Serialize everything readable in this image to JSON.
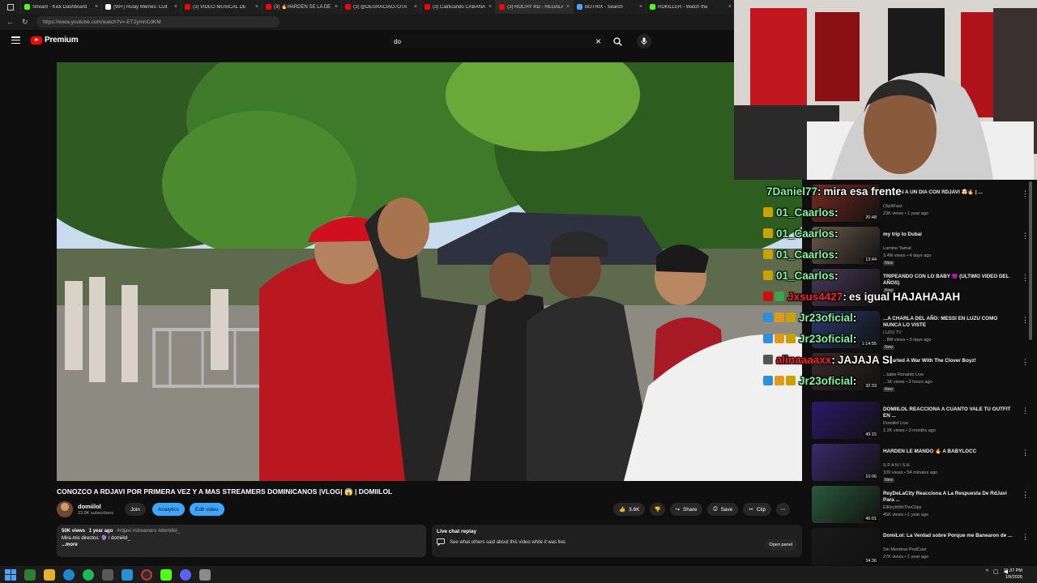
{
  "browser": {
    "tabs": [
      {
        "label": "Stream - Kick Dashboard",
        "color": "#53fc18"
      },
      {
        "label": "(99+) Rulay Memes: Cult",
        "color": "#ffffff"
      },
      {
        "label": "(3) VIDEO MUSICAL DE",
        "color": "#ff0000"
      },
      {
        "label": "(3) 🔥HARDEN SE LA DE",
        "color": "#ff0000"
      },
      {
        "label": "(3) @DEGRACIAO7OTA",
        "color": "#ff0000"
      },
      {
        "label": "(3) Calificando CABAÑA",
        "color": "#ff0000"
      },
      {
        "label": "(3) ROCHY RD - REGALA",
        "color": "#ff0000"
      },
      {
        "label": "BOTRIX - Search",
        "color": "#4aa3ff"
      },
      {
        "label": "RDKILLER - Watch the",
        "color": "#53fc18"
      }
    ],
    "url": "https://www.youtube.com/watch?v=-ET2ymnCdKM",
    "back_icon": "arrow-left-icon",
    "reload_icon": "reload-icon"
  },
  "youtube": {
    "logo_text": "Premium",
    "search_query": "do",
    "video_title": "CONOZCO A RDJAVI POR PRIMERA VEZ Y A MAS STREAMERS DOMINICANOS |VLOG| 😱 | DOMIILOL",
    "channel_name": "domiilol",
    "subscribers": "23.9K subscribers",
    "join_label": "Join",
    "analytics_label": "Analytics",
    "edit_label": "Edit video",
    "likes": "3.6K",
    "share_label": "Share",
    "save_label": "Save",
    "clip_label": "Clip",
    "more_label": "⋯",
    "desc_views": "50K views",
    "desc_time": "1 year ago",
    "desc_tags": "#rdjavi #streamers #domiilol_",
    "desc_line2": "Mira mis directos: 🔮 / domiilol_",
    "desc_more": "...more",
    "chat_replay_title": "Live chat replay",
    "chat_replay_sub": "See what others said about this video while it was live.",
    "open_panel_label": "Open panel"
  },
  "recommendations": [
    {
      "title": "...CCIÓN A UN DIA CON RDJAVI 🤯🔥 | ...",
      "channel": "ClipItFast",
      "meta": "23K views • 1 year ago",
      "duration": "20:48",
      "badge": ""
    },
    {
      "title": "my trip to Dubai",
      "channel": "Lamine Yamal",
      "meta": "3.4M views • 4 days ago",
      "duration": "13:44",
      "badge": "New"
    },
    {
      "title": "TRIPEANDO CON LO BABY 😈 (ULTIMO VIDEO DEL AÑOS)",
      "channel": "",
      "meta": "",
      "duration": "",
      "badge": "New"
    },
    {
      "title": "...A CHARLA DEL AÑO: MESSI EN LUZU COMO NUNCA LO VISTE",
      "channel": "LUZU TV",
      "meta": "...8M views • 3 days ago",
      "duration": "1:14:55",
      "badge": "New"
    },
    {
      "title": "...Started A War With The Clover Boyz!",
      "channel": "...table Ronaldo Live",
      "meta": "...1K views • 2 hours ago",
      "duration": "32:33",
      "badge": "New"
    },
    {
      "title": "DOMIILOL REACCIONA A CUANTO VALE TU OUTFIT EN ...",
      "channel": "Domiilol Live",
      "meta": "1.2K views • 3 months ago",
      "duration": "49:15",
      "badge": ""
    },
    {
      "title": "HARDEN LE MANDO 🔥 A BABYLOCC",
      "channel": "S P A N I S H",
      "meta": "109 views • 54 minutes ago",
      "duration": "10:06",
      "badge": "New"
    },
    {
      "title": "ReyDeLaCity Reacciona A La Respuesta De RdJavi Para ...",
      "channel": "ElReyWithTheClips",
      "meta": "45K views • 1 year ago",
      "duration": "46:01",
      "badge": ""
    },
    {
      "title": "DomiLol: La Verdad sobre Porque me Banearon de ...",
      "channel": "Sin Mentiras PodCast",
      "meta": "27K views • 1 year ago",
      "duration": "34:36",
      "badge": ""
    }
  ],
  "chat_overlay": [
    {
      "user": "7Daniel77",
      "user_color": "#7cfc9a",
      "msg": "mira esa frente",
      "badges": []
    },
    {
      "user": "01_Caarlos",
      "user_color": "#7cfc9a",
      "msg": "",
      "badges": [
        "#c9a200"
      ]
    },
    {
      "user": "01_Caarlos",
      "user_color": "#7cfc9a",
      "msg": "",
      "badges": [
        "#c9a200"
      ]
    },
    {
      "user": "01_Caarlos",
      "user_color": "#7cfc9a",
      "msg": "",
      "badges": [
        "#c9a200"
      ]
    },
    {
      "user": "01_Caarlos",
      "user_color": "#7cfc9a",
      "msg": "",
      "badges": [
        "#c9a200"
      ]
    },
    {
      "user": "Jxsus4427",
      "user_color": "#ff2020",
      "msg": "es igual HAJAHAJAH",
      "badges": [
        "#cc1010",
        "#3fa34d"
      ]
    },
    {
      "user": "Jr23oficial",
      "user_color": "#7cfc9a",
      "msg": "",
      "badges": [
        "#2f8fd8",
        "#e39a1c",
        "#c9a200"
      ]
    },
    {
      "user": "Jr23oficial",
      "user_color": "#7cfc9a",
      "msg": "",
      "badges": [
        "#2f8fd8",
        "#e39a1c",
        "#c9a200"
      ]
    },
    {
      "user": "alinaaaaxx",
      "user_color": "#ff2020",
      "msg": "JAJAJA SI",
      "badges": [
        "#555555"
      ]
    },
    {
      "user": "Jr23oficial",
      "user_color": "#7cfc9a",
      "msg": "",
      "badges": [
        "#2f8fd8",
        "#e39a1c",
        "#c9a200"
      ]
    }
  ],
  "taskbar": {
    "time": "11:37 PM",
    "date": "1/9/2026"
  }
}
